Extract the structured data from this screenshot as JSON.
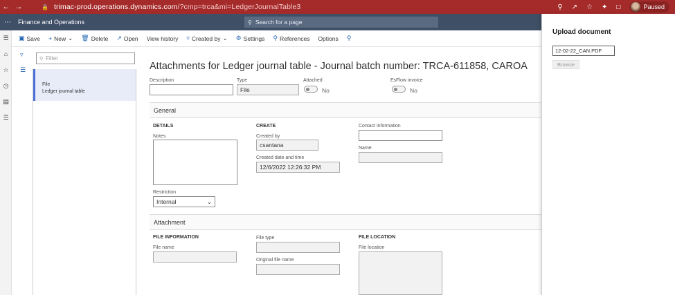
{
  "browser": {
    "url_host": "trimac-prod.operations.dynamics.com",
    "url_path": "/?cmp=trca&mi=LedgerJournalTable3",
    "profile_label": "Paused"
  },
  "appbar": {
    "title": "Finance and Operations",
    "search_placeholder": "Search for a page"
  },
  "toolbar": {
    "save": "Save",
    "new": "New",
    "delete": "Delete",
    "open": "Open",
    "view_history": "View history",
    "created_by": "Created by",
    "settings": "Settings",
    "references": "References",
    "options": "Options"
  },
  "list": {
    "filter_placeholder": "Filter",
    "items": [
      {
        "line1": "File",
        "line2": "Ledger journal table"
      }
    ]
  },
  "main": {
    "title": "Attachments for Ledger journal table - Journal batch number: TRCA-611858, CAROA",
    "header": {
      "description_label": "Description",
      "description_value": "",
      "type_label": "Type",
      "type_value": "File",
      "attached_label": "Attached",
      "attached_value": "No",
      "esflow_label": "EsFlow invoice",
      "esflow_value": "No"
    },
    "general": {
      "section_title": "General",
      "details_group": "DETAILS",
      "notes_label": "Notes",
      "restriction_label": "Restriction",
      "restriction_value": "Internal",
      "create_group": "CREATE",
      "created_by_label": "Created by",
      "created_by_value": "csantana",
      "created_dt_label": "Created date and time",
      "created_dt_value": "12/6/2022 12:26:32 PM",
      "contact_label": "Contact information",
      "name_label": "Name"
    },
    "attachment": {
      "section_title": "Attachment",
      "file_info_group": "FILE INFORMATION",
      "file_name_label": "File name",
      "file_type_label": "File type",
      "original_name_label": "Original file name",
      "file_location_group": "FILE LOCATION",
      "file_location_label": "File location"
    }
  },
  "upload": {
    "title": "Upload document",
    "file_value": "12-02-22_CAN.PDF",
    "browse_label": "Browse"
  }
}
